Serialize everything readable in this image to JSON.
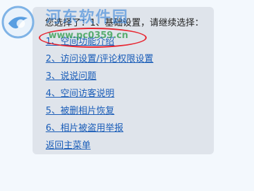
{
  "chat": {
    "intro_text": "您选择了：1、基础设置，请继续选择：",
    "menu_items": [
      {
        "label": "1、空间功能介绍"
      },
      {
        "label": "2、访问设置/评论权限设置"
      },
      {
        "label": "3、说说问题"
      },
      {
        "label": "4、空间访客说明"
      },
      {
        "label": "5、被删相片恢复"
      },
      {
        "label": "6、相片被盗用举报"
      },
      {
        "label": "返回主菜单"
      }
    ]
  },
  "watermark": {
    "brand_text": "河东软件园",
    "url_text": "www.pc0359.cn"
  },
  "colors": {
    "bubble_bg": "#dfe4eb",
    "link": "#1a5db8",
    "highlight": "#e8242f"
  }
}
